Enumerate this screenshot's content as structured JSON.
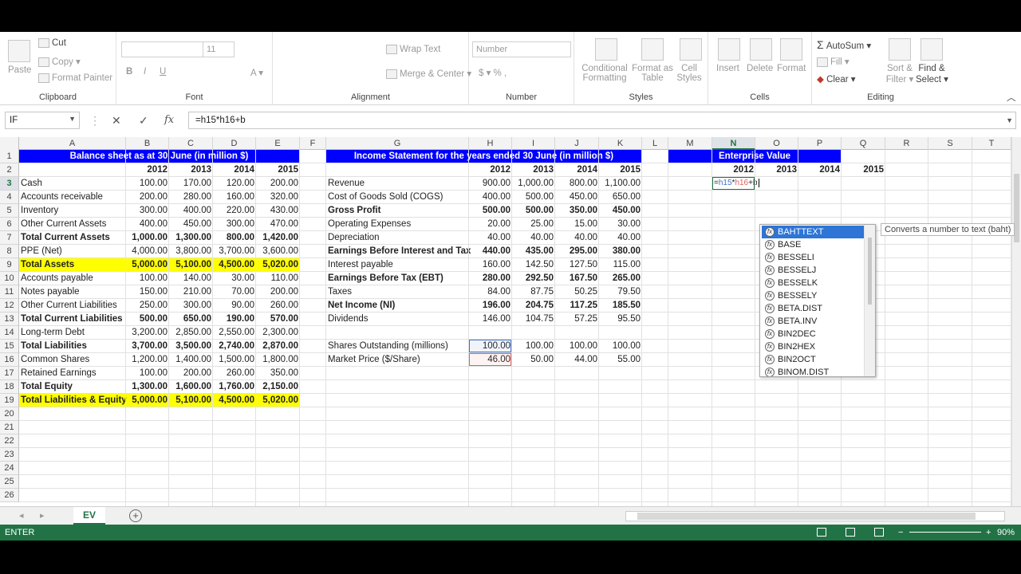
{
  "ribbon": {
    "clipboard": {
      "paste": "Paste",
      "cut": "Cut",
      "copy": "Copy",
      "format_painter": "Format Painter",
      "label": "Clipboard"
    },
    "font": {
      "font_size": "11",
      "label": "Font"
    },
    "alignment": {
      "wrap_text": "Wrap Text",
      "merge_center": "Merge & Center",
      "label": "Alignment"
    },
    "number": {
      "format": "Number",
      "label": "Number"
    },
    "styles": {
      "conditional": "Conditional",
      "formatting": "Formatting",
      "format_as": "Format as",
      "table": "Table",
      "cell": "Cell",
      "styles": "Styles",
      "label": "Styles"
    },
    "cells": {
      "insert": "Insert",
      "delete": "Delete",
      "format": "Format",
      "label": "Cells"
    },
    "editing": {
      "autosum": "AutoSum",
      "fill": "Fill",
      "clear": "Clear",
      "sort": "Sort &",
      "filter": "Filter",
      "find": "Find &",
      "select": "Select",
      "label": "Editing"
    }
  },
  "formula_bar": {
    "name_box": "IF",
    "formula": "=h15*h16+b"
  },
  "columns": [
    "A",
    "B",
    "C",
    "D",
    "E",
    "F",
    "G",
    "H",
    "I",
    "J",
    "K",
    "L",
    "M",
    "N",
    "O",
    "P",
    "Q",
    "R",
    "S",
    "T"
  ],
  "rows": [
    "1",
    "2",
    "3",
    "4",
    "5",
    "6",
    "7",
    "8",
    "9",
    "10",
    "11",
    "12",
    "13",
    "14",
    "15",
    "16",
    "17",
    "18",
    "19",
    "20",
    "21",
    "22",
    "23",
    "24",
    "25",
    "26"
  ],
  "balance_sheet": {
    "title": "Balance sheet as at 30 June (in million $)",
    "years": [
      "2012",
      "2013",
      "2014",
      "2015"
    ],
    "rows": [
      {
        "label": "Cash",
        "v": [
          "100.00",
          "170.00",
          "120.00",
          "200.00"
        ],
        "bold": false
      },
      {
        "label": "Accounts receivable",
        "v": [
          "200.00",
          "280.00",
          "160.00",
          "320.00"
        ],
        "bold": false
      },
      {
        "label": "Inventory",
        "v": [
          "300.00",
          "400.00",
          "220.00",
          "430.00"
        ],
        "bold": false
      },
      {
        "label": "Other Current Assets",
        "v": [
          "400.00",
          "450.00",
          "300.00",
          "470.00"
        ],
        "bold": false
      },
      {
        "label": "Total Current Assets",
        "v": [
          "1,000.00",
          "1,300.00",
          "800.00",
          "1,420.00"
        ],
        "bold": true
      },
      {
        "label": "PPE (Net)",
        "v": [
          "4,000.00",
          "3,800.00",
          "3,700.00",
          "3,600.00"
        ],
        "bold": false
      },
      {
        "label": "Total Assets",
        "v": [
          "5,000.00",
          "5,100.00",
          "4,500.00",
          "5,020.00"
        ],
        "bold": true,
        "highlight": true
      },
      {
        "label": "Accounts payable",
        "v": [
          "100.00",
          "140.00",
          "30.00",
          "110.00"
        ],
        "bold": false
      },
      {
        "label": "Notes payable",
        "v": [
          "150.00",
          "210.00",
          "70.00",
          "200.00"
        ],
        "bold": false
      },
      {
        "label": "Other Current Liabilities",
        "v": [
          "250.00",
          "300.00",
          "90.00",
          "260.00"
        ],
        "bold": false
      },
      {
        "label": "Total Current Liabilities",
        "v": [
          "500.00",
          "650.00",
          "190.00",
          "570.00"
        ],
        "bold": true
      },
      {
        "label": "Long-term Debt",
        "v": [
          "3,200.00",
          "2,850.00",
          "2,550.00",
          "2,300.00"
        ],
        "bold": false
      },
      {
        "label": "Total Liabilities",
        "v": [
          "3,700.00",
          "3,500.00",
          "2,740.00",
          "2,870.00"
        ],
        "bold": true
      },
      {
        "label": "Common Shares",
        "v": [
          "1,200.00",
          "1,400.00",
          "1,500.00",
          "1,800.00"
        ],
        "bold": false
      },
      {
        "label": "Retained Earnings",
        "v": [
          "100.00",
          "200.00",
          "260.00",
          "350.00"
        ],
        "bold": false
      },
      {
        "label": "Total Equity",
        "v": [
          "1,300.00",
          "1,600.00",
          "1,760.00",
          "2,150.00"
        ],
        "bold": true
      },
      {
        "label": "Total Liabilities & Equity",
        "v": [
          "5,000.00",
          "5,100.00",
          "4,500.00",
          "5,020.00"
        ],
        "bold": true,
        "highlight": true
      }
    ]
  },
  "income_statement": {
    "title": "Income Statement for the years ended 30 June (in million $)",
    "years": [
      "2012",
      "2013",
      "2014",
      "2015"
    ],
    "rows": [
      {
        "label": "Revenue",
        "v": [
          "900.00",
          "1,000.00",
          "800.00",
          "1,100.00"
        ],
        "bold": false
      },
      {
        "label": "Cost of Goods Sold (COGS)",
        "v": [
          "400.00",
          "500.00",
          "450.00",
          "650.00"
        ],
        "bold": false
      },
      {
        "label": "Gross Profit",
        "v": [
          "500.00",
          "500.00",
          "350.00",
          "450.00"
        ],
        "bold": true
      },
      {
        "label": "Operating Expenses",
        "v": [
          "20.00",
          "25.00",
          "15.00",
          "30.00"
        ],
        "bold": false
      },
      {
        "label": "Depreciation",
        "v": [
          "40.00",
          "40.00",
          "40.00",
          "40.00"
        ],
        "bold": false
      },
      {
        "label": "Earnings Before Interest and Tax",
        "v": [
          "440.00",
          "435.00",
          "295.00",
          "380.00"
        ],
        "bold": true
      },
      {
        "label": "Interest payable",
        "v": [
          "160.00",
          "142.50",
          "127.50",
          "115.00"
        ],
        "bold": false
      },
      {
        "label": "Earnings Before Tax (EBT)",
        "v": [
          "280.00",
          "292.50",
          "167.50",
          "265.00"
        ],
        "bold": true
      },
      {
        "label": "Taxes",
        "v": [
          "84.00",
          "87.75",
          "50.25",
          "79.50"
        ],
        "bold": false
      },
      {
        "label": "Net Income (NI)",
        "v": [
          "196.00",
          "204.75",
          "117.25",
          "185.50"
        ],
        "bold": true
      },
      {
        "label": "Dividends",
        "v": [
          "146.00",
          "104.75",
          "57.25",
          "95.50"
        ],
        "bold": false
      }
    ],
    "shares": {
      "label": "Shares Outstanding (millions)",
      "v": [
        "100.00",
        "100.00",
        "100.00",
        "100.00"
      ]
    },
    "price": {
      "label": "Market Price ($/Share)",
      "v": [
        "46.00",
        "50.00",
        "44.00",
        "55.00"
      ]
    }
  },
  "enterprise_value": {
    "title": "Enterprise Value",
    "years": [
      "2012",
      "2013",
      "2014",
      "2015"
    ],
    "editing_cell": "=h15*h16+b"
  },
  "autocomplete": {
    "items": [
      "BAHTTEXT",
      "BASE",
      "BESSELI",
      "BESSELJ",
      "BESSELK",
      "BESSELY",
      "BETA.DIST",
      "BETA.INV",
      "BIN2DEC",
      "BIN2HEX",
      "BIN2OCT",
      "BINOM.DIST"
    ],
    "tooltip": "Converts a number to text (baht)"
  },
  "sheet_tab": "EV",
  "status": {
    "mode": "ENTER",
    "zoom": "90%"
  }
}
